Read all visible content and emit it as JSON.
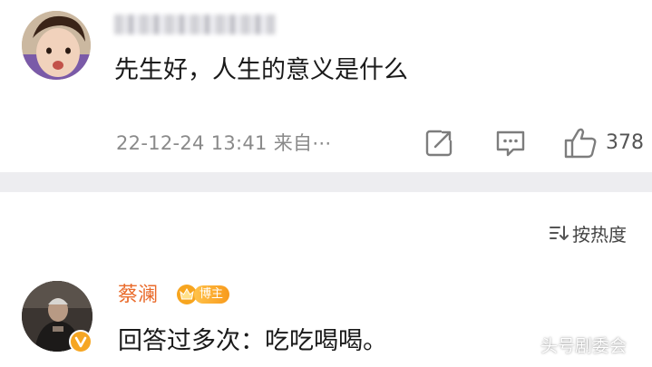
{
  "post": {
    "text": "先生好，人生的意义是什么",
    "meta": "22-12-24 13:41 来自⋯",
    "like_count": "378"
  },
  "comments": {
    "sort_label": "按热度"
  },
  "reply": {
    "author": "蔡澜",
    "badge_label": "博主",
    "text": "回答过多次：吃吃喝喝。"
  },
  "watermark": "头号剧委会",
  "colors": {
    "author_name": "#e96a2a",
    "badge": "#f89a1c",
    "separator": "#ededf0",
    "meta_text": "#8a8a8a"
  },
  "icons": {
    "share": "share-icon",
    "comment": "comment-icon",
    "like": "thumbs-up-icon",
    "sort": "sort-icon",
    "verified": "verified-v-icon",
    "blogger": "crown-icon"
  }
}
